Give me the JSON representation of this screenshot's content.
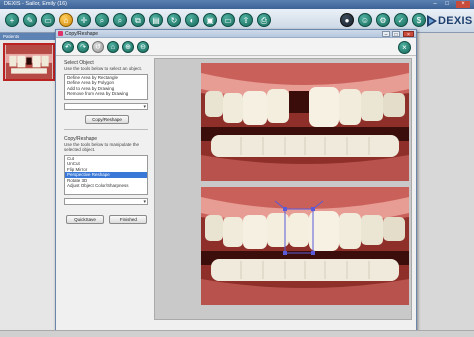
{
  "app": {
    "title": "DEXIS",
    "patient": "Sailor, Emily (16)",
    "logo_text": "DEXIS",
    "window_controls": [
      "minimize",
      "maximize",
      "close"
    ]
  },
  "toolbar": {
    "icons": [
      "new-icon",
      "edit-icon",
      "folder-icon",
      "zoom-icon",
      "zoom-in-icon",
      "zoom-out-icon",
      "move-icon",
      "copy-icon",
      "grid-icon",
      "rotate-icon",
      "adjust-icon",
      "image-icon",
      "import-icon",
      "export-icon",
      "print-icon",
      "info-icon",
      "user-icon",
      "settings-icon",
      "refresh-icon",
      "dollar-icon",
      "help-icon"
    ]
  },
  "left_panel": {
    "title": "Patients"
  },
  "dialog": {
    "title": "Copy/Reshape",
    "toolbar_icons": [
      "rotate-left-icon",
      "rotate-right-icon",
      "undo-icon",
      "home-icon",
      "zoom-in-icon",
      "zoom-out-icon"
    ],
    "select_section": {
      "title": "Select Object",
      "description": "Use the tools below to select an object.",
      "options": [
        "Define Area by Rectangle",
        "Define Area by Polygon",
        "Add to Area by Drawing",
        "Remove from Area by Drawing"
      ],
      "copy_button": "Copy/Reshape"
    },
    "reshape_section": {
      "title": "Copy/Reshape",
      "description": "Use the tools below to manipulate the selected object.",
      "options": [
        "Cut",
        "UnCut",
        "Flip Mirror",
        "Perspective Reshape",
        "Rotate 3D",
        "Adjust Object Color/Sharpness"
      ],
      "selected_index": 3
    },
    "buttons": {
      "quicksave": "QuickSave",
      "finished": "Finished"
    }
  },
  "colors": {
    "accent": "#3a78d8",
    "toolbar_button": "#186a5c",
    "titlebar": "#3d6296",
    "selection_box": "#5a5ad8"
  }
}
